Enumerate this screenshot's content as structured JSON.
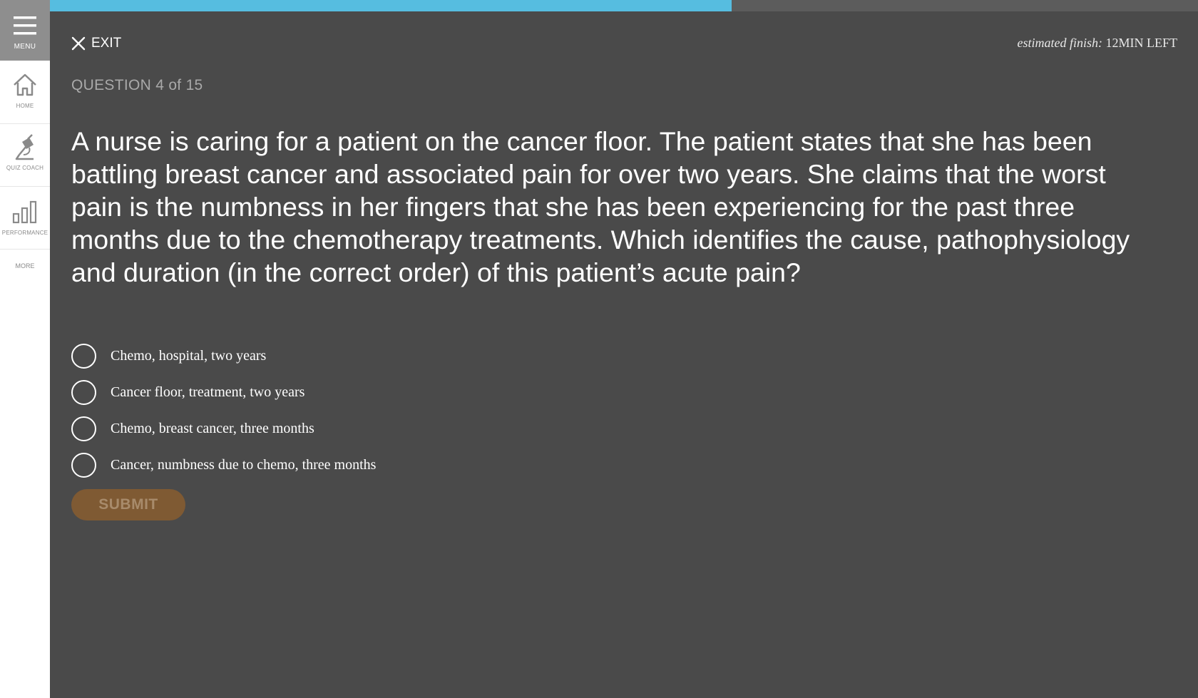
{
  "sidebar": {
    "menu_label": "MENU",
    "items": [
      {
        "label": "HOME",
        "icon": "home-icon"
      },
      {
        "label": "QUIZ COACH",
        "icon": "quiz-coach-icon"
      },
      {
        "label": "PERFORMANCE",
        "icon": "bar-chart-icon"
      }
    ],
    "more_label": "MORE"
  },
  "progress": {
    "fraction": 0.594,
    "fill_color": "#56bde0",
    "track_color": "#5c5c5c"
  },
  "header": {
    "exit_label": "EXIT",
    "estimate_prefix": "estimated finish:",
    "estimate_value": "12MIN LEFT"
  },
  "question": {
    "counter": "QUESTION 4 of 15",
    "text": "A nurse is caring for a patient on the cancer floor. The patient states that she has been battling breast cancer and associated pain for over two years. She claims that the worst pain is the numbness in her fingers that she has been experiencing for the past three months due to the chemotherapy treatments. Which identifies the cause, pathophysiology and duration (in the correct order) of this patient’s acute pain?",
    "options": [
      "Chemo, hospital, two years",
      "Cancer floor, treatment, two years",
      "Chemo, breast cancer, three months",
      "Cancer, numbness due to chemo, three months"
    ]
  },
  "submit_label": "SUBMIT",
  "colors": {
    "background": "#4a4a4a",
    "sidebar": "#ffffff",
    "menu_bg": "#8e8e8e",
    "submit_bg": "#7f5a33"
  }
}
